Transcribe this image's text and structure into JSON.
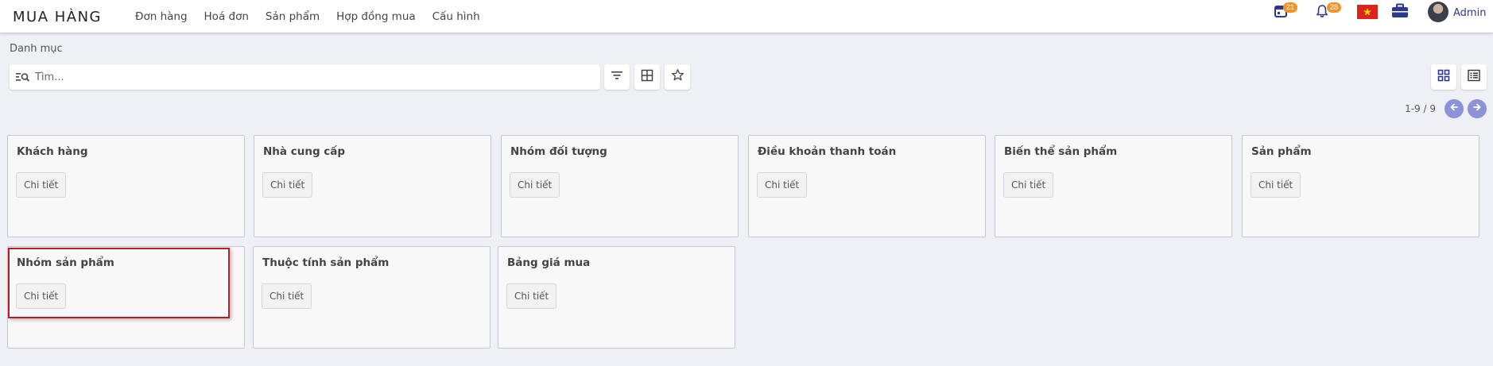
{
  "app": {
    "title": "MUA HÀNG"
  },
  "nav": {
    "items": [
      {
        "label": "Đơn hàng"
      },
      {
        "label": "Hoá đơn"
      },
      {
        "label": "Sản phẩm"
      },
      {
        "label": "Hợp đồng mua"
      },
      {
        "label": "Cấu hình"
      }
    ]
  },
  "header_right": {
    "calendar_badge": "21",
    "notification_badge": "28",
    "user_name": "Admin"
  },
  "breadcrumb": "Danh mục",
  "search": {
    "placeholder": "Tìm..."
  },
  "pager": {
    "range": "1-9 / 9"
  },
  "card_button_label": "Chi tiết",
  "cards": [
    {
      "title": "Khách hàng",
      "button": "Chi tiết"
    },
    {
      "title": "Nhà cung cấp",
      "button": "Chi tiết"
    },
    {
      "title": "Nhóm đối tượng",
      "button": "Chi tiết"
    },
    {
      "title": "Điều khoản thanh toán",
      "button": "Chi tiết"
    },
    {
      "title": "Biến thể sản phẩm",
      "button": "Chi tiết"
    },
    {
      "title": "Sản phẩm",
      "button": "Chi tiết"
    },
    {
      "title": "Nhóm sản phẩm",
      "button": "Chi tiết"
    },
    {
      "title": "Thuộc tính sản phẩm",
      "button": "Chi tiết"
    },
    {
      "title": "Bảng giá mua",
      "button": "Chi tiết"
    }
  ],
  "colors": {
    "accent": "#8a92d8",
    "badge": "#f0932b",
    "highlight": "#b51f24"
  }
}
